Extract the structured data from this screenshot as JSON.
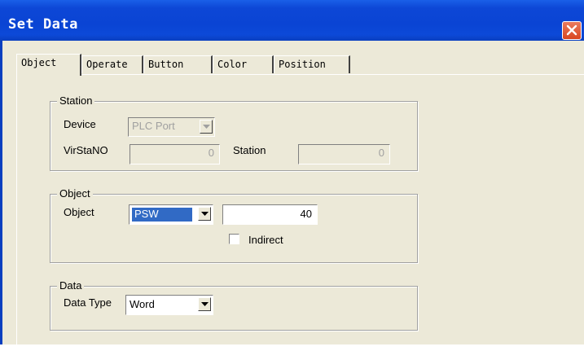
{
  "window": {
    "title": "Set Data"
  },
  "tabs": [
    {
      "label": "Object"
    },
    {
      "label": "Operate"
    },
    {
      "label": "Button"
    },
    {
      "label": "Color"
    },
    {
      "label": "Position"
    }
  ],
  "station": {
    "legend": "Station",
    "device_label": "Device",
    "device_value": "PLC Port",
    "virstano_label": "VirStaNO",
    "virstano_value": "0",
    "station_label": "Station",
    "station_value": "0"
  },
  "object_group": {
    "legend": "Object",
    "object_label": "Object",
    "object_value": "PSW",
    "address_value": "40",
    "indirect_label": "Indirect",
    "indirect_checked": false
  },
  "data_group": {
    "legend": "Data",
    "data_type_label": "Data Type",
    "data_type_value": "Word"
  },
  "colors": {
    "title_bar": "#0a44d4",
    "face": "#ece9d8",
    "selection": "#316ac5",
    "disabled_text": "#a0a0a0"
  },
  "icons": {
    "close": "close-icon",
    "dropdown": "chevron-down-icon"
  }
}
